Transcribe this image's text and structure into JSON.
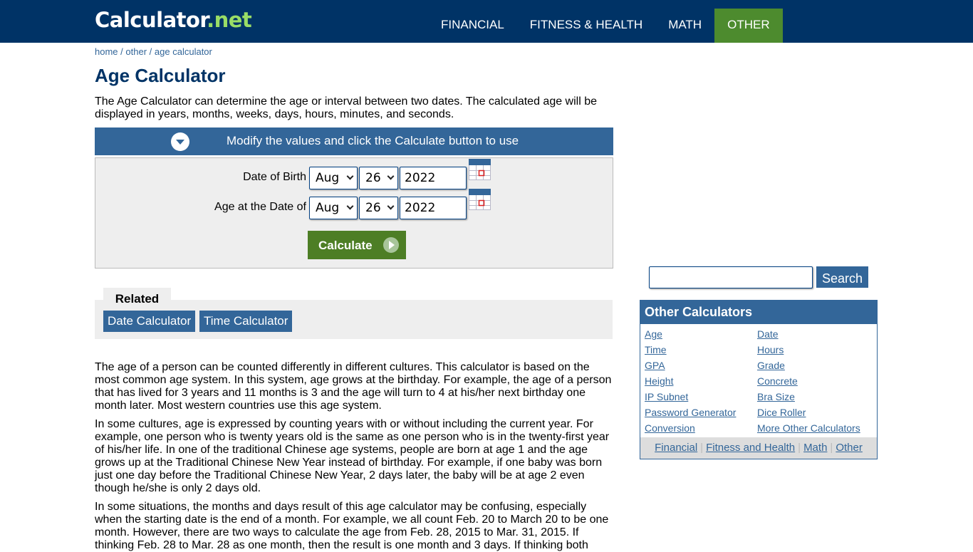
{
  "header": {
    "logo_main": "Calculator",
    "logo_suffix": ".net",
    "nav": [
      {
        "label": "FINANCIAL",
        "active": false
      },
      {
        "label": "FITNESS & HEALTH",
        "active": false
      },
      {
        "label": "MATH",
        "active": false
      },
      {
        "label": "OTHER",
        "active": true
      }
    ]
  },
  "breadcrumb": {
    "items": [
      "home",
      "other",
      "age calculator"
    ],
    "separator": "/"
  },
  "page_title": "Age Calculator",
  "intro": "The Age Calculator can determine the age or interval between two dates. The calculated age will be displayed in years, months, weeks, days, hours, minutes, and seconds.",
  "panel": {
    "header_label": "Modify the values and click the Calculate button to use",
    "toggle_icon": "chevron-down-circle-icon",
    "rows": [
      {
        "label": "Date of Birth",
        "month": "Aug",
        "day": "26",
        "year": "2022"
      },
      {
        "label": "Age at the Date of",
        "month": "Aug",
        "day": "26",
        "year": "2022"
      }
    ],
    "calculate_label": "Calculate"
  },
  "related": {
    "title": "Related",
    "links": [
      "Date Calculator",
      "Time Calculator"
    ]
  },
  "article": [
    "The age of a person can be counted differently in different cultures. This calculator is based on the most common age system. In this system, age grows at the birthday. For example, the age of a person that has lived for 3 years and 11 months is 3 and the age will turn to 4 at his/her next birthday one month later. Most western countries use this age system.",
    "In some cultures, age is expressed by counting years with or without including the current year. For example, one person who is twenty years old is the same as one person who is in the twenty-first year of his/her life. In one of the traditional Chinese age systems, people are born at age 1 and the age grows up at the Traditional Chinese New Year instead of birthday. For example, if one baby was born just one day before the Traditional Chinese New Year, 2 days later, the baby will be at age 2 even though he/she is only 2 days old.",
    "In some situations, the months and days result of this age calculator may be confusing, especially when the starting date is the end of a month. For example, we all count Feb. 20 to March 20 to be one month. However, there are two ways to calculate the age from Feb. 28, 2015 to Mar. 31, 2015. If thinking Feb. 28 to Mar. 28 as one month, then the result is one month and 3 days. If thinking both"
  ],
  "sidebar": {
    "search_value": "",
    "search_label": "Search",
    "other_title": "Other Calculators",
    "links_left": [
      "Age",
      "Time",
      "GPA",
      "Height",
      "IP Subnet",
      "Password Generator",
      "Conversion"
    ],
    "links_right": [
      "Date",
      "Hours",
      "Grade",
      "Concrete",
      "Bra Size",
      "Dice Roller",
      "More Other Calculators"
    ],
    "footer_links": [
      "Financial",
      "Fitness and Health",
      "Math",
      "Other"
    ],
    "footer_separator": "|"
  },
  "colors": {
    "header_bg": "#003366",
    "active_nav": "#4d8b2e",
    "accent_blue": "#336699",
    "calculate_green": "#4d7e25",
    "logo_suffix": "#99dd66"
  }
}
